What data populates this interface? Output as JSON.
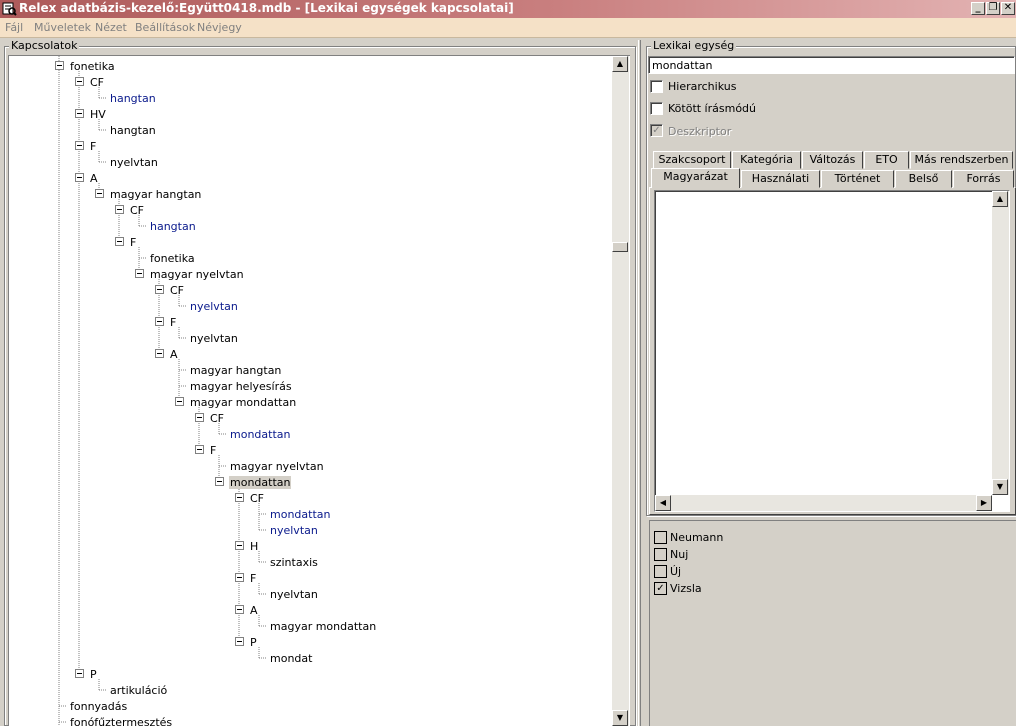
{
  "window": {
    "title": "Relex adatbázis-kezelő:Együtt0418.mdb - [Lexikai egységek kapcsolatai]",
    "btn_minimize": "_",
    "btn_restore": "❐",
    "btn_close": "✕"
  },
  "menu": {
    "items": [
      "Fájl",
      "Műveletek",
      "Nézet",
      "Beállítások",
      "Névjegy"
    ]
  },
  "relations": {
    "group_label": "Kapcsolatok",
    "nodes": [
      {
        "label": "fonetika",
        "link": false
      },
      {
        "label": "CF",
        "link": false
      },
      {
        "label": "hangtan",
        "link": true
      },
      {
        "label": "HV",
        "link": false
      },
      {
        "label": "hangtan",
        "link": false
      },
      {
        "label": "F",
        "link": false
      },
      {
        "label": "nyelvtan",
        "link": false
      },
      {
        "label": "A",
        "link": false
      },
      {
        "label": "magyar hangtan",
        "link": false
      },
      {
        "label": "CF",
        "link": false
      },
      {
        "label": "hangtan",
        "link": true
      },
      {
        "label": "F",
        "link": false
      },
      {
        "label": "fonetika",
        "link": false
      },
      {
        "label": "magyar nyelvtan",
        "link": false
      },
      {
        "label": "CF",
        "link": false
      },
      {
        "label": "nyelvtan",
        "link": true
      },
      {
        "label": "F",
        "link": false
      },
      {
        "label": "nyelvtan",
        "link": false
      },
      {
        "label": "A",
        "link": false
      },
      {
        "label": "magyar hangtan",
        "link": false
      },
      {
        "label": "magyar helyesírás",
        "link": false
      },
      {
        "label": "magyar mondattan",
        "link": false
      },
      {
        "label": "CF",
        "link": false
      },
      {
        "label": "mondattan",
        "link": true
      },
      {
        "label": "F",
        "link": false
      },
      {
        "label": "magyar nyelvtan",
        "link": false
      },
      {
        "label": "mondattan",
        "link": false,
        "selected": true
      },
      {
        "label": "CF",
        "link": false
      },
      {
        "label": "mondattan",
        "link": true
      },
      {
        "label": "nyelvtan",
        "link": true
      },
      {
        "label": "H",
        "link": false
      },
      {
        "label": "szintaxis",
        "link": false
      },
      {
        "label": "F",
        "link": false
      },
      {
        "label": "nyelvtan",
        "link": false
      },
      {
        "label": "A",
        "link": false
      },
      {
        "label": "magyar mondattan",
        "link": false
      },
      {
        "label": "P",
        "link": false
      },
      {
        "label": "mondat",
        "link": false
      },
      {
        "label": "P",
        "link": false
      },
      {
        "label": "artikuláció",
        "link": false
      },
      {
        "label": "fonnyadás",
        "link": false
      },
      {
        "label": "fonófűztermesztés",
        "link": false
      }
    ]
  },
  "lexical_unit": {
    "group_label": "Lexikai egység",
    "value": "mondattan",
    "hierarchical_label": "Hierarchikus",
    "hierarchical_checked": false,
    "bound_spelling_label": "Kötött írásmódú",
    "bound_spelling_checked": false,
    "descriptor_label": "Deszkriptor",
    "descriptor_checked": true
  },
  "tabs": {
    "row_back": [
      "Szakcsoport",
      "Kategória",
      "Változás",
      "ETO",
      "Más rendszerben"
    ],
    "row_front": [
      "Magyarázat",
      "Használati",
      "Történet",
      "Belső",
      "Forrás"
    ],
    "active": "Magyarázat"
  },
  "explanation_text": "",
  "sources": [
    {
      "label": "Neumann",
      "checked": false
    },
    {
      "label": "Nuj",
      "checked": false
    },
    {
      "label": "Új",
      "checked": false
    },
    {
      "label": "Vizsla",
      "checked": true
    }
  ]
}
